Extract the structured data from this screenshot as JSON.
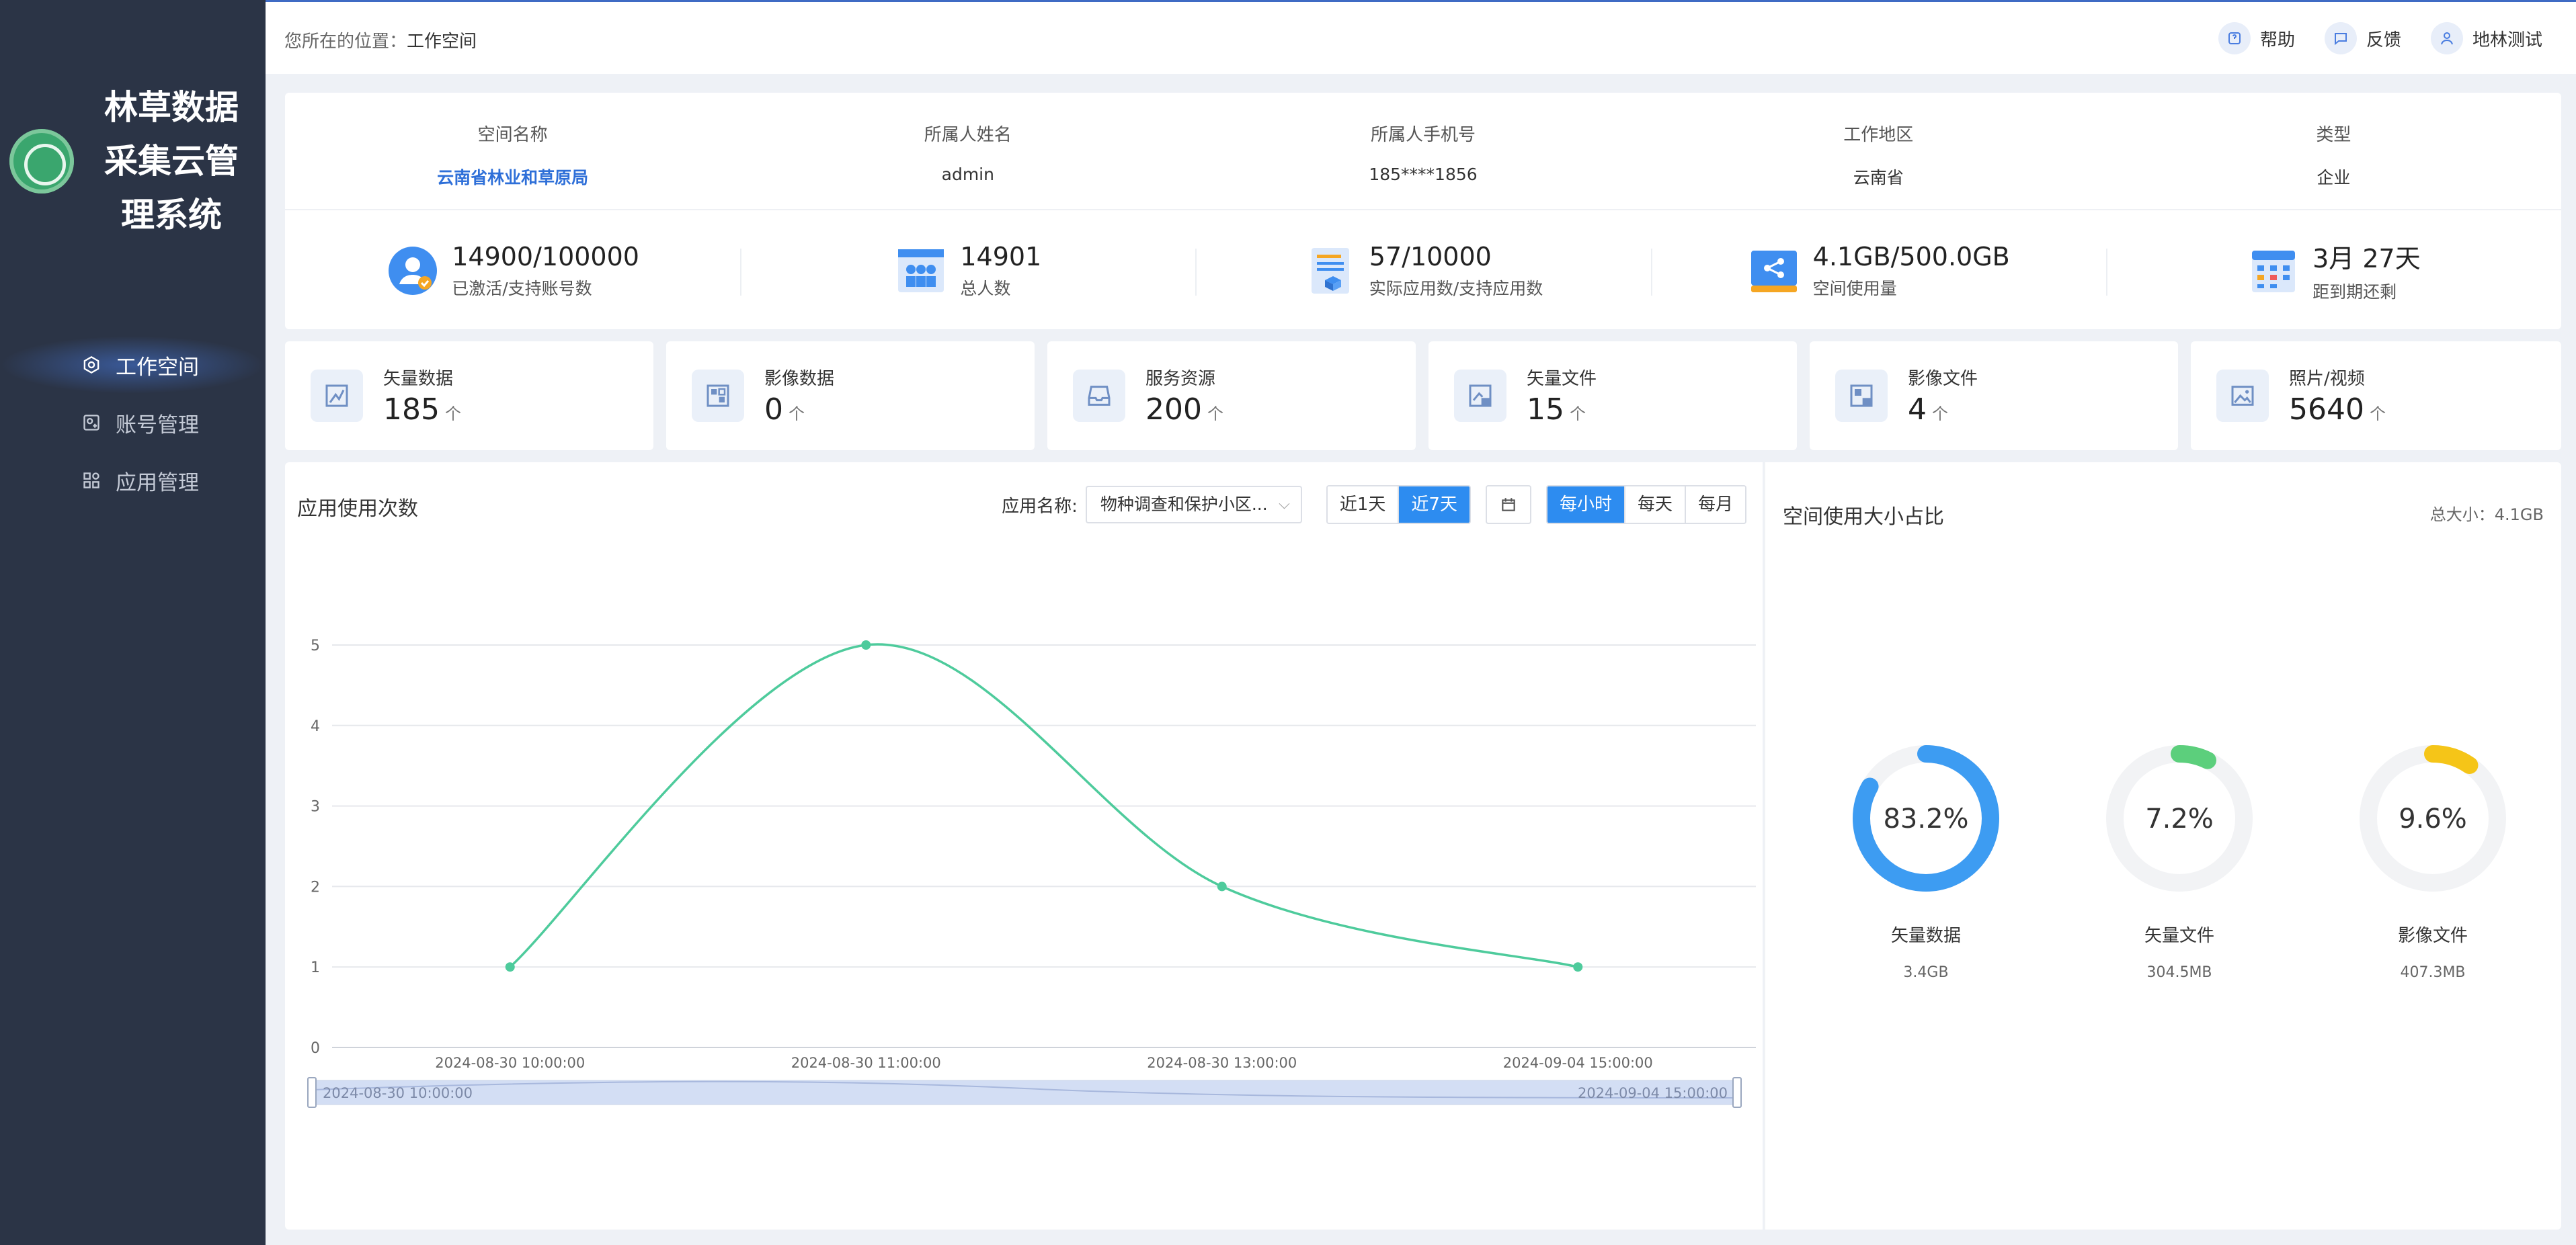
{
  "sidebar": {
    "title": "林草数据\n采集云管\n理系统",
    "nav": [
      {
        "label": "工作空间",
        "icon": "gear-icon",
        "active": true
      },
      {
        "label": "账号管理",
        "icon": "account-icon",
        "active": false
      },
      {
        "label": "应用管理",
        "icon": "apps-icon",
        "active": false
      }
    ]
  },
  "header": {
    "crumb_prefix": "您所在的位置：",
    "crumb_current": "工作空间",
    "help_label": "帮助",
    "feedback_label": "反馈",
    "user_label": "地林测试"
  },
  "info": {
    "cols": [
      {
        "label": "空间名称",
        "value": "云南省林业和草原局"
      },
      {
        "label": "所属人姓名",
        "value": "admin"
      },
      {
        "label": "所属人手机号",
        "value": "185****1856"
      },
      {
        "label": "工作地区",
        "value": "云南省"
      },
      {
        "label": "类型",
        "value": "企业"
      }
    ],
    "stats": [
      {
        "main": "14900/100000",
        "sub": "已激活/支持账号数",
        "icon": "user-icon"
      },
      {
        "main": "14901",
        "sub": "总人数",
        "icon": "group-icon"
      },
      {
        "main": "57/10000",
        "sub": "实际应用数/支持应用数",
        "icon": "document-icon"
      },
      {
        "main": "4.1GB/500.0GB",
        "sub": "空间使用量",
        "icon": "storage-icon"
      },
      {
        "main": "3月 27天",
        "sub": "距到期还剩",
        "icon": "calendar-icon"
      }
    ]
  },
  "resources": [
    {
      "name": "矢量数据",
      "value": "185",
      "unit": "个",
      "icon": "vector-icon"
    },
    {
      "name": "影像数据",
      "value": "0",
      "unit": "个",
      "icon": "image-grid-icon"
    },
    {
      "name": "服务资源",
      "value": "200",
      "unit": "个",
      "icon": "inbox-icon"
    },
    {
      "name": "矢量文件",
      "value": "15",
      "unit": "个",
      "icon": "vector-file-icon"
    },
    {
      "name": "影像文件",
      "value": "4",
      "unit": "个",
      "icon": "image-file-icon"
    },
    {
      "name": "照片/视频",
      "value": "5640",
      "unit": "个",
      "icon": "photo-icon"
    }
  ],
  "usage": {
    "title": "应用使用次数",
    "filter_label": "应用名称:",
    "selected_app": "物种调查和保护小区...",
    "range_buttons": [
      "近1天",
      "近7天"
    ],
    "range_active": 1,
    "granularity_buttons": [
      "每小时",
      "每天",
      "每月"
    ],
    "granularity_active": 0,
    "slider_start": "2024-08-30 10:00:00",
    "slider_end": "2024-09-04 15:00:00"
  },
  "chart_data": {
    "type": "line",
    "title": "应用使用次数",
    "xlabel": "",
    "ylabel": "",
    "x": [
      "2024-08-30 10:00:00",
      "2024-08-30 11:00:00",
      "2024-08-30 13:00:00",
      "2024-09-04 15:00:00"
    ],
    "series": [
      {
        "values": [
          1,
          5,
          2,
          1
        ]
      }
    ],
    "ylim": [
      0,
      5
    ],
    "yticks": [
      0,
      1,
      2,
      3,
      4,
      5
    ],
    "grid": true,
    "color": "#4ecb9c"
  },
  "space": {
    "title": "空间使用大小占比",
    "total": "总大小：4.1GB",
    "items": [
      {
        "percent": "83.2%",
        "fraction": 0.832,
        "name": "矢量数据",
        "size": "3.4GB",
        "color": "#3d9cf2"
      },
      {
        "percent": "7.2%",
        "fraction": 0.072,
        "name": "矢量文件",
        "size": "304.5MB",
        "color": "#5ccf7c"
      },
      {
        "percent": "9.6%",
        "fraction": 0.096,
        "name": "影像文件",
        "size": "407.3MB",
        "color": "#f5c518"
      }
    ]
  }
}
